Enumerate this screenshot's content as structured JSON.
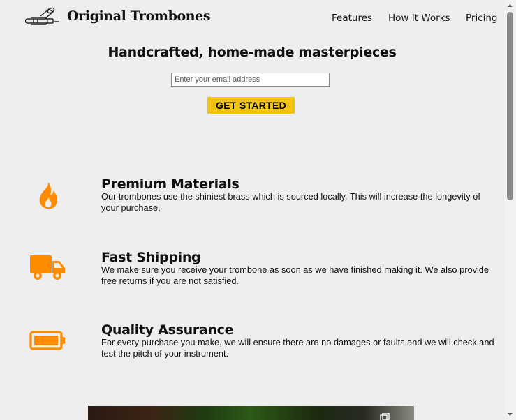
{
  "header": {
    "logo_text": "Original Trombones",
    "nav": [
      {
        "label": "Features"
      },
      {
        "label": "How It Works"
      },
      {
        "label": "Pricing"
      }
    ]
  },
  "hero": {
    "title": "Handcrafted, home-made masterpieces",
    "email_placeholder": "Enter your email address",
    "cta_label": "GET STARTED"
  },
  "features": [
    {
      "icon": "flame-icon",
      "title": "Premium Materials",
      "description": "Our trombones use the shiniest brass which is sourced locally. This will increase the longevity of your purchase."
    },
    {
      "icon": "truck-icon",
      "title": "Fast Shipping",
      "description": "We make sure you receive your trombone as soon as we have finished making it. We also provide free returns if you are not satisfied."
    },
    {
      "icon": "battery-icon",
      "title": "Quality Assurance",
      "description": "For every purchase you make, we will ensure there are no damages or faults and we will check and test the pitch of your instrument."
    }
  ],
  "colors": {
    "accent": "#f1c40f",
    "icon_orange": "#ff8c00",
    "background": "#eeeeee"
  }
}
